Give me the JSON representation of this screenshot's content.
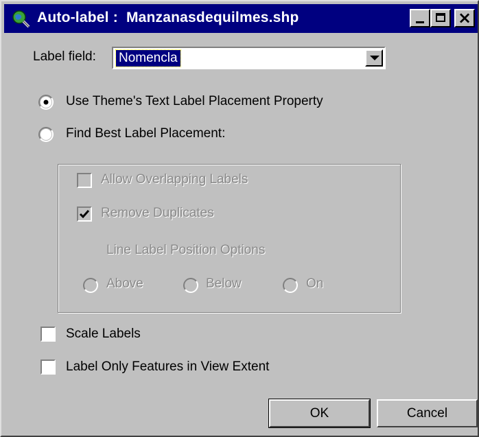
{
  "window": {
    "title": "Auto-label :  Manzanasdequilmes.shp",
    "icon": "globe-magnifier-icon",
    "controls": {
      "minimize": "minimize-icon",
      "maximize": "maximize-icon",
      "close": "×"
    }
  },
  "label_field": {
    "label": "Label field:",
    "value": "Nomencla"
  },
  "placement": {
    "use_theme_label": "Use Theme's Text Label Placement Property",
    "find_best_label": "Find Best Label Placement:",
    "selected": "use_theme"
  },
  "best_options": {
    "allow_overlap": {
      "label": "Allow Overlapping Labels",
      "checked": false,
      "enabled": false
    },
    "remove_duplicates": {
      "label": "Remove Duplicates",
      "checked": true,
      "enabled": false
    },
    "line_position_title": "Line Label Position Options",
    "positions": {
      "above": "Above",
      "below": "Below",
      "on": "On"
    }
  },
  "scale_labels": {
    "label": "Scale Labels",
    "checked": false
  },
  "view_extent": {
    "label": "Label Only Features in View Extent",
    "checked": false
  },
  "buttons": {
    "ok": "OK",
    "cancel": "Cancel"
  },
  "colors": {
    "titlebar": "#000080",
    "face": "#c0c0c0",
    "disabled_text": "#8a8a8a"
  }
}
